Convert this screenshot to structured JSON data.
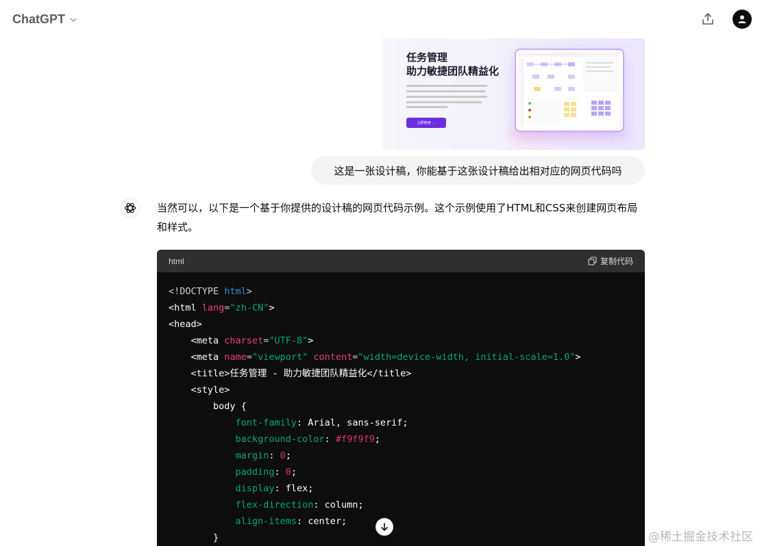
{
  "header": {
    "model_name": "ChatGPT",
    "share_icon": "share-upload-icon",
    "avatar_icon": "user-icon"
  },
  "design_image": {
    "title_line1": "任务管理",
    "title_line2": "助力敏捷团队精益化",
    "button_label": "立即使用 →"
  },
  "user_message": "这是一张设计稿，你能基于这张设计稿给出相对应的网页代码吗",
  "assistant": {
    "reply": "当然可以，以下是一个基于你提供的设计稿的网页代码示例。这个示例使用了HTML和CSS来创建网页布局和样式。",
    "code": {
      "language": "html",
      "copy_label": "复制代码",
      "lines": [
        [
          [
            "punct",
            "<!DOCTYPE "
          ],
          [
            "kw",
            "html"
          ],
          [
            "punct",
            ">"
          ]
        ],
        [
          [
            "tag",
            "<html "
          ],
          [
            "attr",
            "lang"
          ],
          [
            "punct",
            "="
          ],
          [
            "str",
            "\"zh-CN\""
          ],
          [
            "tag",
            ">"
          ]
        ],
        [
          [
            "tag",
            "<head>"
          ]
        ],
        [
          [
            "plain",
            "    "
          ],
          [
            "tag",
            "<meta "
          ],
          [
            "attr",
            "charset"
          ],
          [
            "punct",
            "="
          ],
          [
            "str",
            "\"UTF-8\""
          ],
          [
            "tag",
            ">"
          ]
        ],
        [
          [
            "plain",
            "    "
          ],
          [
            "tag",
            "<meta "
          ],
          [
            "attr",
            "name"
          ],
          [
            "punct",
            "="
          ],
          [
            "str",
            "\"viewport\""
          ],
          [
            "plain",
            " "
          ],
          [
            "attr",
            "content"
          ],
          [
            "punct",
            "="
          ],
          [
            "str",
            "\"width=device-width, initial-scale=1.0\""
          ],
          [
            "tag",
            ">"
          ]
        ],
        [
          [
            "plain",
            "    "
          ],
          [
            "tag",
            "<title>"
          ],
          [
            "plain",
            "任务管理 - 助力敏捷团队精益化"
          ],
          [
            "tag",
            "</title>"
          ]
        ],
        [
          [
            "plain",
            "    "
          ],
          [
            "tag",
            "<style>"
          ]
        ],
        [
          [
            "plain",
            "        body {"
          ]
        ],
        [
          [
            "plain",
            "            "
          ],
          [
            "prop",
            "font-family"
          ],
          [
            "plain",
            ": Arial, sans-serif;"
          ]
        ],
        [
          [
            "plain",
            "            "
          ],
          [
            "prop",
            "background-color"
          ],
          [
            "plain",
            ": "
          ],
          [
            "num",
            "#f9f9f9"
          ],
          [
            "plain",
            ";"
          ]
        ],
        [
          [
            "plain",
            "            "
          ],
          [
            "prop",
            "margin"
          ],
          [
            "plain",
            ": "
          ],
          [
            "num",
            "0"
          ],
          [
            "plain",
            ";"
          ]
        ],
        [
          [
            "plain",
            "            "
          ],
          [
            "prop",
            "padding"
          ],
          [
            "plain",
            ": "
          ],
          [
            "num",
            "0"
          ],
          [
            "plain",
            ";"
          ]
        ],
        [
          [
            "plain",
            "            "
          ],
          [
            "prop",
            "display"
          ],
          [
            "plain",
            ": flex;"
          ]
        ],
        [
          [
            "plain",
            "            "
          ],
          [
            "prop",
            "flex-direction"
          ],
          [
            "plain",
            ": column;"
          ]
        ],
        [
          [
            "plain",
            "            "
          ],
          [
            "prop",
            "align-items"
          ],
          [
            "plain",
            ": center;"
          ]
        ],
        [
          [
            "plain",
            "        }"
          ]
        ]
      ]
    }
  },
  "scroll_icon": "arrow-down-icon",
  "watermark": "@稀土掘金技术社区"
}
